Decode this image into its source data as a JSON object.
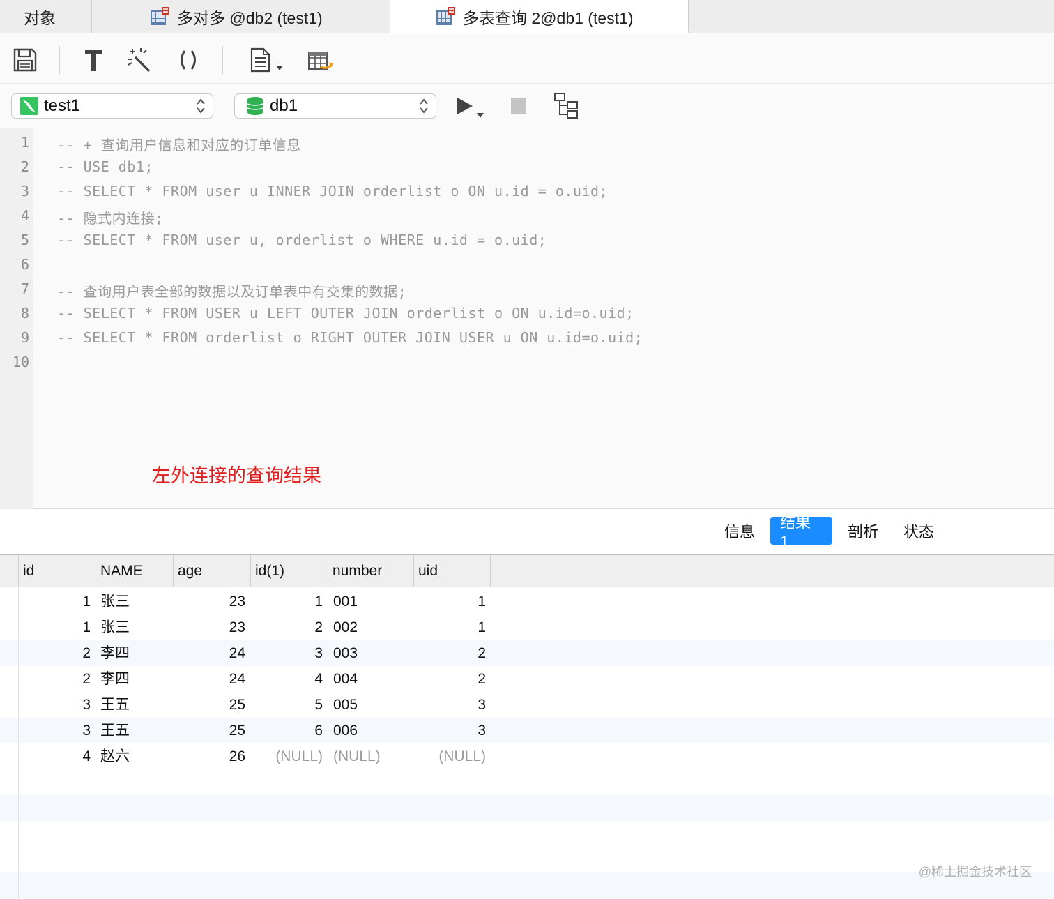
{
  "tabs": {
    "objects": "对象",
    "tab1": "多对多 @db2 (test1)",
    "tab2": "多表查询 2@db1 (test1)"
  },
  "toolbar": {
    "icons": [
      "save-icon",
      "format-icon",
      "beautify-icon",
      "parentheses-icon",
      "snippet-icon",
      "table-export-icon"
    ]
  },
  "connection": {
    "connection_name": "test1",
    "database_name": "db1"
  },
  "editor": {
    "line_numbers": [
      "1",
      "2",
      "3",
      "4",
      "5",
      "6",
      "7",
      "8",
      "9",
      "10"
    ],
    "lines": [
      "-- + 查询用户信息和对应的订单信息",
      "-- USE db1;",
      "-- SELECT * FROM user u INNER JOIN orderlist o ON u.id = o.uid;",
      "-- 隐式内连接;",
      "-- SELECT * FROM user u, orderlist o WHERE u.id = o.uid;",
      "",
      "-- 查询用户表全部的数据以及订单表中有交集的数据;",
      "-- SELECT * FROM USER u LEFT OUTER JOIN orderlist o ON u.id=o.uid;",
      "-- SELECT * FROM orderlist o RIGHT OUTER JOIN USER u ON u.id=o.uid;",
      ""
    ],
    "annotation": "左外连接的查询结果",
    "annotation_color": "#e21d1d"
  },
  "result_tabs": {
    "info": "信息",
    "result1": "结果 1",
    "profile": "剖析",
    "status": "状态",
    "active_color": "#1a8cff"
  },
  "grid": {
    "columns": [
      "id",
      "NAME",
      "age",
      "id(1)",
      "number",
      "uid"
    ],
    "rows": [
      [
        "1",
        "张三",
        "23",
        "1",
        "001",
        "1"
      ],
      [
        "1",
        "张三",
        "23",
        "2",
        "002",
        "1"
      ],
      [
        "2",
        "李四",
        "24",
        "3",
        "003",
        "2"
      ],
      [
        "2",
        "李四",
        "24",
        "4",
        "004",
        "2"
      ],
      [
        "3",
        "王五",
        "25",
        "5",
        "005",
        "3"
      ],
      [
        "3",
        "王五",
        "25",
        "6",
        "006",
        "3"
      ],
      [
        "4",
        "赵六",
        "26",
        "(NULL)",
        "(NULL)",
        "(NULL)"
      ]
    ]
  },
  "watermark": "@稀土掘金技术社区"
}
